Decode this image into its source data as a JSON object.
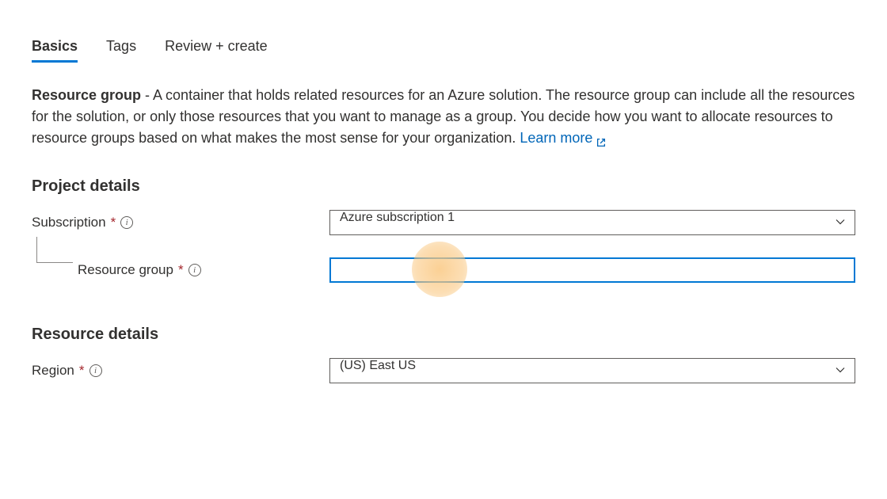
{
  "tabs": {
    "basics": "Basics",
    "tags": "Tags",
    "review": "Review + create"
  },
  "description": {
    "lead": "Resource group",
    "body": " - A container that holds related resources for an Azure solution. The resource group can include all the resources for the solution, or only those resources that you want to manage as a group. You decide how you want to allocate resources to resource groups based on what makes the most sense for your organization. ",
    "learn_more": "Learn more"
  },
  "project_details": {
    "title": "Project details",
    "subscription_label": "Subscription",
    "subscription_value": "Azure subscription 1",
    "resource_group_label": "Resource group",
    "resource_group_value": ""
  },
  "resource_details": {
    "title": "Resource details",
    "region_label": "Region",
    "region_value": "(US) East US"
  }
}
